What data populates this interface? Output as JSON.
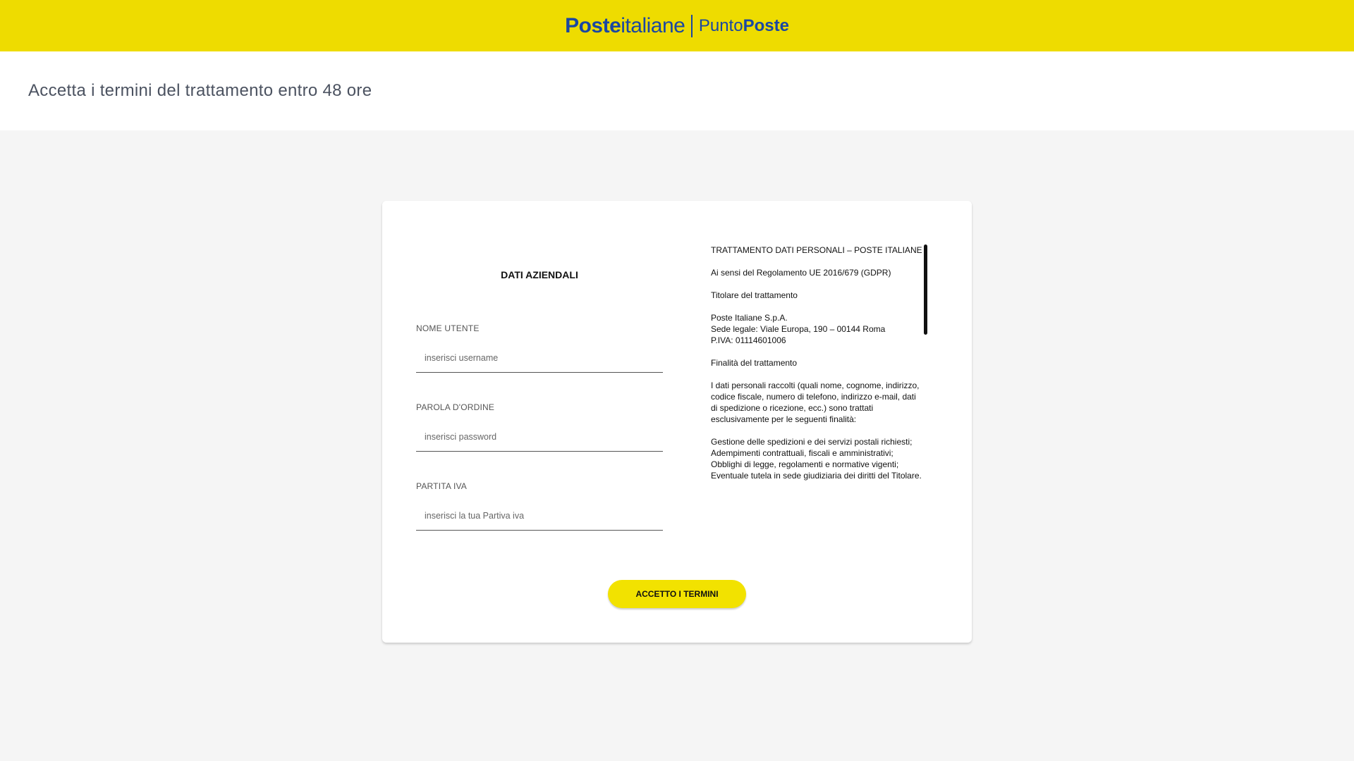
{
  "header": {
    "logo_bold": "Poste",
    "logo_regular": "italiane",
    "punto_regular": "Punto",
    "punto_bold": "Poste",
    "brand_color": "#1a47a2",
    "bar_color": "#eedc00"
  },
  "page": {
    "title": "Accetta i termini del trattamento entro 48 ore"
  },
  "form": {
    "section_title": "DATI AZIENDALI",
    "fields": [
      {
        "label": "NOME UTENTE",
        "placeholder": "inserisci username"
      },
      {
        "label": "PAROLA D'ORDINE",
        "placeholder": "inserisci password"
      },
      {
        "label": "PARTITA IVA",
        "placeholder": "inserisci la tua Partiva iva"
      }
    ]
  },
  "terms": {
    "heading": "TRATTAMENTO DATI PERSONALI – POSTE ITALIANE",
    "regulation": "Ai sensi del Regolamento UE 2016/679 (GDPR)",
    "controller_title": "Titolare del trattamento",
    "controller_details": "Poste Italiane S.p.A.\nSede legale: Viale Europa, 190 – 00144 Roma\nP.IVA: 01114601006",
    "purpose_title": "Finalità del trattamento",
    "purpose_intro": "I dati personali raccolti (quali nome, cognome, indirizzo, codice fiscale, numero di telefono, indirizzo e-mail, dati di spedizione o ricezione, ecc.) sono trattati esclusivamente per le seguenti finalità:",
    "purpose_list": "Gestione delle spedizioni e dei servizi postali richiesti;\nAdempimenti contrattuali, fiscali e amministrativi;\nObblighi di legge, regolamenti e normative vigenti;\nEventuale tutela in sede giudiziaria dei diritti del Titolare."
  },
  "actions": {
    "accept_label": "ACCETTO I TERMINI"
  }
}
